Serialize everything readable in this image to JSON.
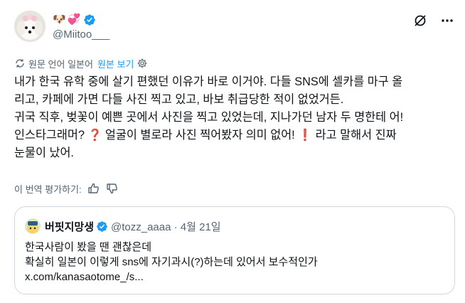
{
  "author": {
    "emojis": [
      "🐶",
      "💞"
    ],
    "handle": "@Miitoo___"
  },
  "header_actions": {
    "icons": [
      "slashed-circle-icon",
      "more-icon"
    ]
  },
  "translation": {
    "note": "원문 언어 일본어",
    "show_original": "원본 보기"
  },
  "tweet": {
    "line1": "내가 한국 유학 중에 살기 편했던 이유가 바로 이거야. 다들 SNS에 셀카를 마구 올",
    "line2": "리고, 카페에 가면 다들 사진 찍고 있고, 바보 취급당한 적이 없었거든.",
    "line3": "귀국 직후, 벚꽃이 예쁜 곳에서 사진을 찍고 있었는데, 지나가던 남자 두 명한테 어!",
    "line4a": "인스타그래머? ",
    "question_mark": "❓",
    "line4b": " 얼굴이 별로라 사진 찍어봤자 의미 없어! ",
    "exclamation_mark": "❗",
    "line4c": " 라고 말해서 진짜",
    "line5": "눈물이 났어."
  },
  "rate": {
    "label": "이 번역 평가하기:"
  },
  "quote": {
    "name": "버핏지망생",
    "handle_date": "@tozz_aaaa · 4월 21일",
    "line1": "한국사람이 봤을 땐 괜찮은데",
    "line2": "확실히 일본이 이렇게 sns에 자기과시(?)하는데 있어서 보수적인가",
    "line3": "x.com/kanasaotome_/s..."
  },
  "colors": {
    "accent": "#1d9bf0",
    "text": "#0f1419",
    "muted": "#536471",
    "border": "#cfd9de",
    "alert": "#d9131f"
  }
}
